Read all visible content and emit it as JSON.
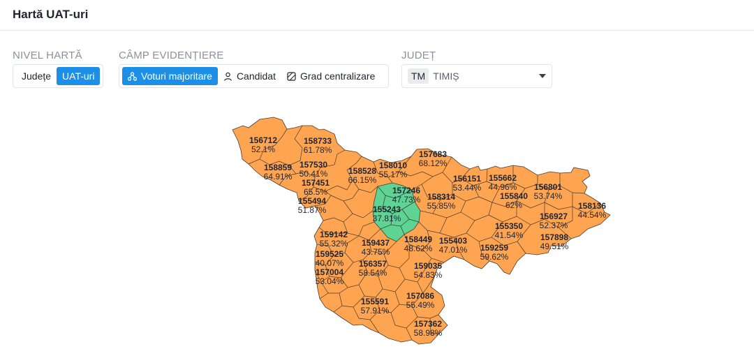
{
  "page_title": "Hartă UAT-uri",
  "controls": {
    "nivel_label": "NIVEL HARTĂ",
    "nivel_options": [
      "Județe",
      "UAT-uri"
    ],
    "camp_label": "CÂMP EVIDENȚIERE",
    "camp_options": [
      "Voturi majoritare",
      "Candidat",
      "Grad centralizare"
    ],
    "judet_label": "JUDEȚ",
    "judet_code": "TM",
    "judet_name": "TIMIȘ"
  },
  "colors": {
    "orange": "#FFA552",
    "green": "#5ED394",
    "accent": "#1E8FE6"
  },
  "labels": [
    {
      "code": "156712",
      "pct": "52.1%"
    },
    {
      "code": "158733",
      "pct": "61.78%"
    },
    {
      "code": "157530",
      "pct": "50.41%"
    },
    {
      "code": "158859",
      "pct": "64.91%"
    },
    {
      "code": "157451",
      "pct": "65.5%"
    },
    {
      "code": "155494",
      "pct": "51.87%"
    },
    {
      "code": "158528",
      "pct": "66.15%"
    },
    {
      "code": "158010",
      "pct": "55.17%"
    },
    {
      "code": "157683",
      "pct": "68.12%"
    },
    {
      "code": "157246",
      "pct": "47.73%"
    },
    {
      "code": "158314",
      "pct": "55.85%"
    },
    {
      "code": "156151",
      "pct": "53.44%"
    },
    {
      "code": "155662",
      "pct": "44.96%"
    },
    {
      "code": "155840",
      "pct": "62%"
    },
    {
      "code": "156801",
      "pct": "53.74%"
    },
    {
      "code": "158136",
      "pct": "44.54%"
    },
    {
      "code": "155243",
      "pct": "37.81%"
    },
    {
      "code": "159142",
      "pct": "55.32%"
    },
    {
      "code": "159437",
      "pct": "43.75%"
    },
    {
      "code": "158449",
      "pct": "48.62%"
    },
    {
      "code": "155403",
      "pct": "47.01%"
    },
    {
      "code": "155350",
      "pct": "41.54%"
    },
    {
      "code": "156927",
      "pct": "52.37%"
    },
    {
      "code": "157898",
      "pct": "49.51%"
    },
    {
      "code": "159259",
      "pct": "59.62%"
    },
    {
      "code": "159525",
      "pct": "40.07%"
    },
    {
      "code": "157004",
      "pct": "53.04%"
    },
    {
      "code": "156357",
      "pct": "58.54%"
    },
    {
      "code": "159035",
      "pct": "54.83%"
    },
    {
      "code": "155591",
      "pct": "57.91%"
    },
    {
      "code": "157086",
      "pct": "55.49%"
    },
    {
      "code": "157362",
      "pct": "58.98%"
    }
  ]
}
